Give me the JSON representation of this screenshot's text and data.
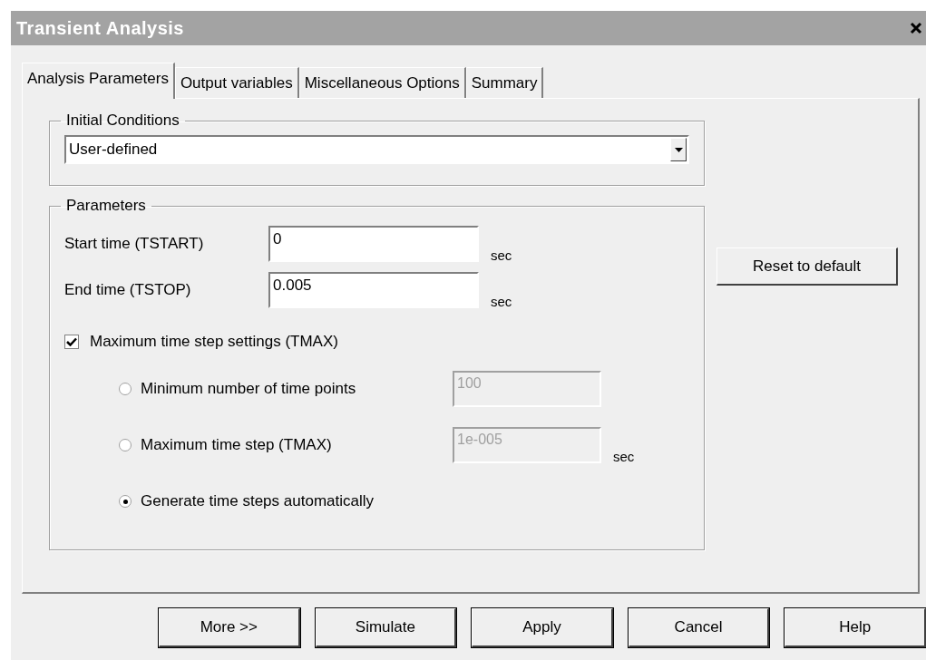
{
  "window": {
    "title": "Transient Analysis"
  },
  "tabs": [
    {
      "label": "Analysis Parameters",
      "selected": true
    },
    {
      "label": "Output variables",
      "selected": false
    },
    {
      "label": "Miscellaneous Options",
      "selected": false
    },
    {
      "label": "Summary",
      "selected": false
    }
  ],
  "initial_conditions": {
    "label": "Initial Conditions",
    "value": "User-defined"
  },
  "parameters": {
    "label": "Parameters",
    "fields": [
      {
        "label": "Start time (TSTART)",
        "value": "0",
        "unit": "sec"
      },
      {
        "label": "End time (TSTOP)",
        "value": "0.005",
        "unit": "sec"
      }
    ],
    "tmax": {
      "label": "Maximum time step settings (TMAX)",
      "checked": true
    },
    "options": [
      {
        "label": "Minimum number of time points",
        "selected": false,
        "value": "100",
        "disabled": true
      },
      {
        "label": "Maximum time step (TMAX)",
        "selected": false,
        "value": "1e-005",
        "unit": "sec",
        "disabled": true
      },
      {
        "label": "Generate time steps automatically",
        "selected": true
      }
    ]
  },
  "reset_button": "Reset to default",
  "buttons": [
    "More >>",
    "Simulate",
    "Apply",
    "Cancel",
    "Help"
  ]
}
